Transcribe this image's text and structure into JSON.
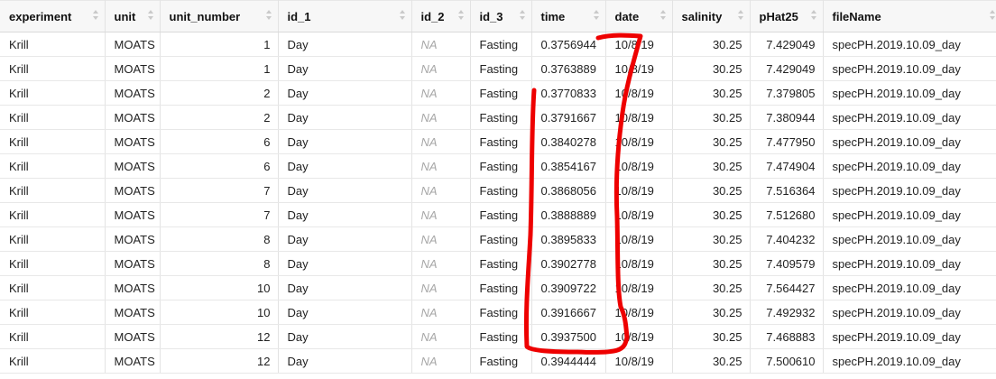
{
  "columns": [
    {
      "key": "experiment",
      "label": "experiment"
    },
    {
      "key": "unit",
      "label": "unit"
    },
    {
      "key": "unit_number",
      "label": "unit_number"
    },
    {
      "key": "id_1",
      "label": "id_1"
    },
    {
      "key": "id_2",
      "label": "id_2"
    },
    {
      "key": "id_3",
      "label": "id_3"
    },
    {
      "key": "time",
      "label": "time"
    },
    {
      "key": "date",
      "label": "date"
    },
    {
      "key": "salinity",
      "label": "salinity"
    },
    {
      "key": "pHat25",
      "label": "pHat25"
    },
    {
      "key": "fileName",
      "label": "fileName"
    }
  ],
  "rows": [
    [
      "Krill",
      "MOATS",
      "1",
      "Day",
      "NA",
      "Fasting",
      "0.3756944",
      "10/8/19",
      "30.25",
      "7.429049",
      "specPH.2019.10.09_day"
    ],
    [
      "Krill",
      "MOATS",
      "1",
      "Day",
      "NA",
      "Fasting",
      "0.3763889",
      "10/8/19",
      "30.25",
      "7.429049",
      "specPH.2019.10.09_day"
    ],
    [
      "Krill",
      "MOATS",
      "2",
      "Day",
      "NA",
      "Fasting",
      "0.3770833",
      "10/8/19",
      "30.25",
      "7.379805",
      "specPH.2019.10.09_day"
    ],
    [
      "Krill",
      "MOATS",
      "2",
      "Day",
      "NA",
      "Fasting",
      "0.3791667",
      "10/8/19",
      "30.25",
      "7.380944",
      "specPH.2019.10.09_day"
    ],
    [
      "Krill",
      "MOATS",
      "6",
      "Day",
      "NA",
      "Fasting",
      "0.3840278",
      "10/8/19",
      "30.25",
      "7.477950",
      "specPH.2019.10.09_day"
    ],
    [
      "Krill",
      "MOATS",
      "6",
      "Day",
      "NA",
      "Fasting",
      "0.3854167",
      "10/8/19",
      "30.25",
      "7.474904",
      "specPH.2019.10.09_day"
    ],
    [
      "Krill",
      "MOATS",
      "7",
      "Day",
      "NA",
      "Fasting",
      "0.3868056",
      "10/8/19",
      "30.25",
      "7.516364",
      "specPH.2019.10.09_day"
    ],
    [
      "Krill",
      "MOATS",
      "7",
      "Day",
      "NA",
      "Fasting",
      "0.3888889",
      "10/8/19",
      "30.25",
      "7.512680",
      "specPH.2019.10.09_day"
    ],
    [
      "Krill",
      "MOATS",
      "8",
      "Day",
      "NA",
      "Fasting",
      "0.3895833",
      "10/8/19",
      "30.25",
      "7.404232",
      "specPH.2019.10.09_day"
    ],
    [
      "Krill",
      "MOATS",
      "8",
      "Day",
      "NA",
      "Fasting",
      "0.3902778",
      "10/8/19",
      "30.25",
      "7.409579",
      "specPH.2019.10.09_day"
    ],
    [
      "Krill",
      "MOATS",
      "10",
      "Day",
      "NA",
      "Fasting",
      "0.3909722",
      "10/8/19",
      "30.25",
      "7.564427",
      "specPH.2019.10.09_day"
    ],
    [
      "Krill",
      "MOATS",
      "10",
      "Day",
      "NA",
      "Fasting",
      "0.3916667",
      "10/8/19",
      "30.25",
      "7.492932",
      "specPH.2019.10.09_day"
    ],
    [
      "Krill",
      "MOATS",
      "12",
      "Day",
      "NA",
      "Fasting",
      "0.3937500",
      "10/8/19",
      "30.25",
      "7.468883",
      "specPH.2019.10.09_day"
    ],
    [
      "Krill",
      "MOATS",
      "12",
      "Day",
      "NA",
      "Fasting",
      "0.3944444",
      "10/8/19",
      "30.25",
      "7.500610",
      "specPH.2019.10.09_day"
    ]
  ],
  "numeric_columns": [
    "unit_number",
    "salinity",
    "pHat25"
  ],
  "na_value": "NA",
  "annotation_color": "#ee0000"
}
